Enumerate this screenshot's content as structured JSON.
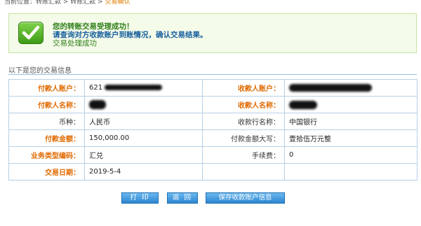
{
  "breadcrumb": {
    "text": "当前位置：转账汇款 > 转账汇款 > ",
    "active": "交易确认"
  },
  "result": {
    "line1": "您的转账交易受理成功！",
    "line2": "请查询对方收款账户到账情况，确认交易结果。",
    "line3": "交易处理成功"
  },
  "section_title": "以下是您的交易信息",
  "table": {
    "payer_account_label": "付款人账户：",
    "payer_account_value": "621",
    "payee_account_label": "收款人账户：",
    "payer_name_label": "付款人名称：",
    "payee_name_label": "收款人名称：",
    "currency_label": "币种：",
    "currency_value": "人民币",
    "payee_bank_label": "收款行名称：",
    "payee_bank_value": "中国银行",
    "amount_label": "付款金额：",
    "amount_value": "150,000.00",
    "amount_words_label": "付款金额大写：",
    "amount_words_value": "壹拾伍万元整",
    "business_type_label": "业务类型编码：",
    "business_type_value": "汇兑",
    "fee_label": "手续费：",
    "fee_value": "0",
    "date_label": "交易日期：",
    "date_value": "2019-5-4"
  },
  "buttons": {
    "print": "打 印",
    "back": "返 回",
    "save_payee": "保存收款账户信息"
  },
  "colors": {
    "label_orange": "#e06a00",
    "success_green": "#2f7f1a",
    "info_blue": "#175f9e",
    "button_blue": "#2e86cf"
  }
}
